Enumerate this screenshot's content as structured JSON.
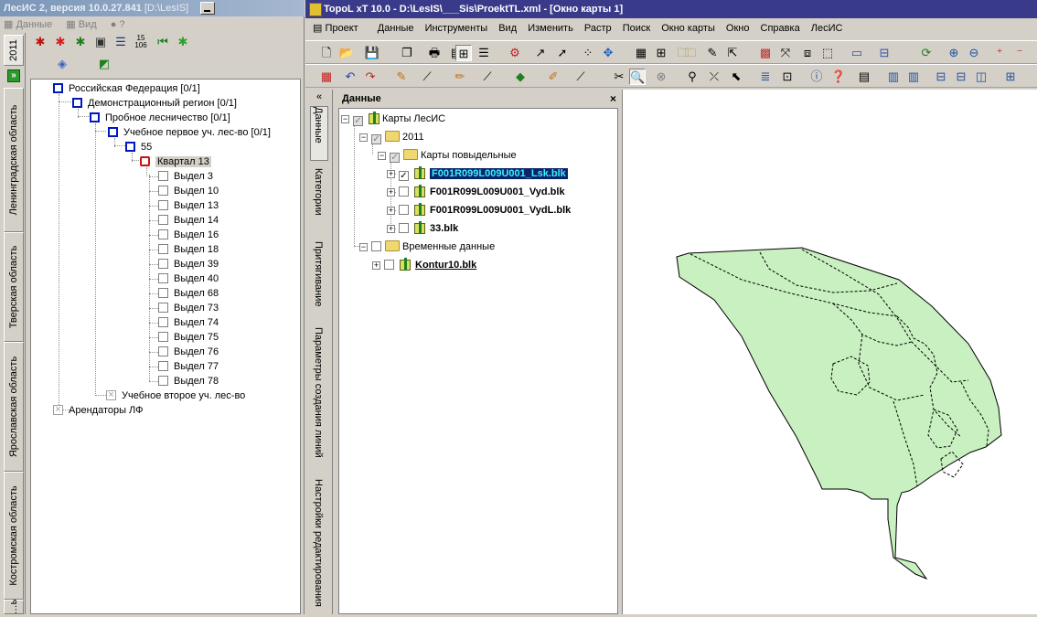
{
  "lesis": {
    "title": "ЛесИС 2, версия 10.0.27.841",
    "title_path": "[D:\\LesIS]",
    "menu": [
      "Данные",
      "Вид",
      "?"
    ],
    "region_tabs": [
      "2011",
      "Ленинградская область",
      "Тверская область",
      "Ярославская область",
      "Костромская область",
      "…ь"
    ],
    "tree": {
      "root": "Российская Федерация [0/1]",
      "region": "Демонстрационный регион [0/1]",
      "forestry": "Пробное лесничество [0/1]",
      "district1": "Учебное первое уч. лес-во [0/1]",
      "block_group": "55",
      "kvartal": "Квартал 13",
      "vydels": [
        "Выдел 3",
        "Выдел 10",
        "Выдел 13",
        "Выдел 14",
        "Выдел 16",
        "Выдел 18",
        "Выдел 39",
        "Выдел 40",
        "Выдел 68",
        "Выдел 73",
        "Выдел 74",
        "Выдел 75",
        "Выдел 76",
        "Выдел 77",
        "Выдел 78"
      ],
      "district2": "Учебное второе уч. лес-во",
      "tenants": "Арендаторы ЛФ"
    }
  },
  "topol": {
    "title": "TopoL xT 10.0 - D:\\LesIS\\___Sis\\ProektTL.xml - [Окно карты 1]",
    "menu": [
      "Проект",
      "Данные",
      "Инструменты",
      "Вид",
      "Изменить",
      "Растр",
      "Поиск",
      "Окно карты",
      "Окно",
      "Справка",
      "ЛесИС"
    ],
    "dock_tabs": [
      "Данные",
      "Категории",
      "Притягивание",
      "Параметры создания линий",
      "Настройки редактирования"
    ],
    "data_panel": {
      "title": "Данные",
      "root": "Карты ЛесИС",
      "year": "2011",
      "group1": "Карты повыдельные",
      "layers": [
        {
          "name": "F001R099L009U001_Lsk.blk",
          "checked": true,
          "selected": true
        },
        {
          "name": "F001R099L009U001_Vyd.blk",
          "checked": false,
          "selected": false
        },
        {
          "name": "F001R099L009U001_VydL.blk",
          "checked": false,
          "selected": false
        },
        {
          "name": "33.blk",
          "checked": false,
          "selected": false
        }
      ],
      "group2": "Временные данные",
      "temp_layer": "Kontur10.blk"
    },
    "map": {
      "fill": "#c8f0c0",
      "stroke": "#000000"
    }
  }
}
